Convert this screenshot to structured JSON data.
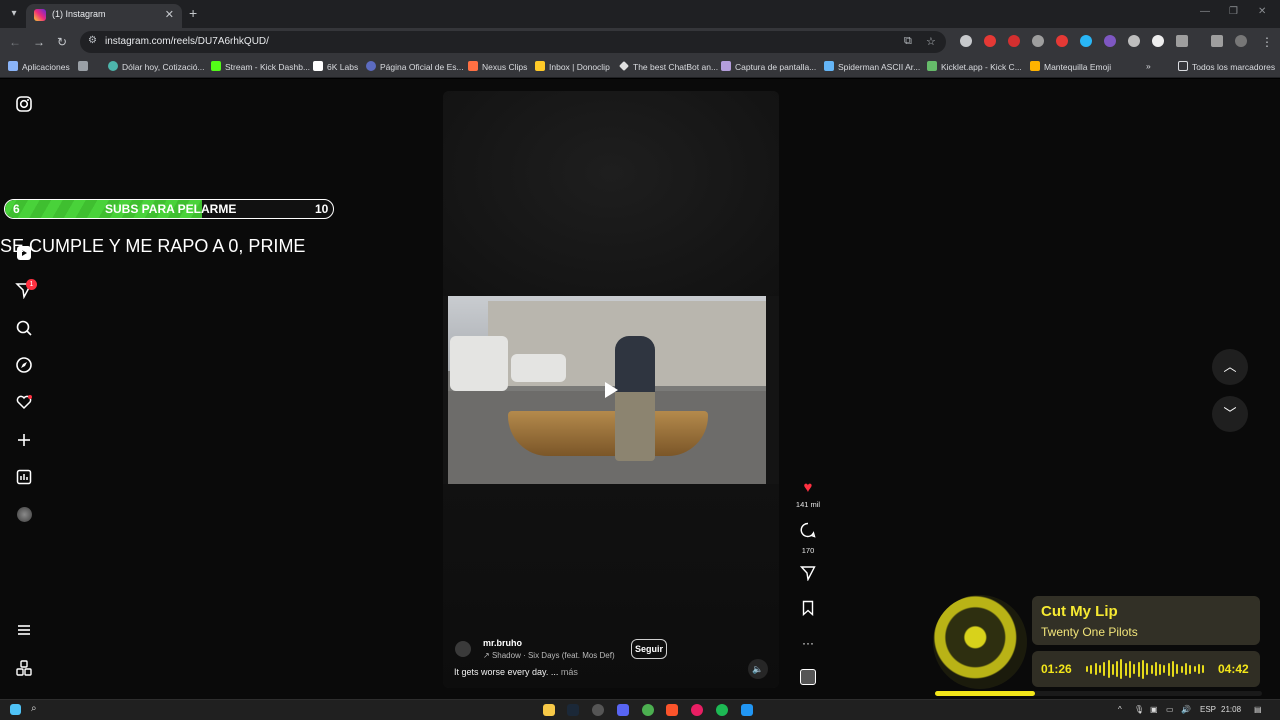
{
  "browser": {
    "tab_title": "(1) Instagram",
    "url": "instagram.com/reels/DU7A6rhkQUD/",
    "bookmarks": [
      "Aplicaciones",
      "Dólar hoy, Cotizació...",
      "Stream - Kick Dashb...",
      "6K Labs",
      "Página Oficial de Es...",
      "Nexus Clips",
      "Inbox | Donoclip",
      "The best ChatBot an...",
      "Captura de pantalla...",
      "Spiderman ASCII Ar...",
      "Kicklet.app - Kick C...",
      "Mantequilla Emoji"
    ],
    "bookmarks_folder": "Todos los marcadores"
  },
  "sidebar": {
    "notification_badge": "1"
  },
  "overlay": {
    "current": "6",
    "label": "SUBS PARA PELARME",
    "goal": "10",
    "progress_fraction": 0.6,
    "line": "SE CUMPLE Y ME RAPO A 0, PRIME"
  },
  "reel": {
    "author": "mr.bruho",
    "audio": "Shadow · Six Days (feat. Mos Def)",
    "follow_label": "Seguir",
    "caption": "It gets worse every day. ...",
    "more_label": "más",
    "likes": "141 mil",
    "comments": "170"
  },
  "music": {
    "title": "Cut My Lip",
    "artist": "Twenty One Pilots",
    "elapsed": "01:26",
    "duration": "04:42",
    "progress_fraction": 0.305,
    "accent": "#f3e61a"
  },
  "taskbar": {
    "lang": "ESP",
    "time": "21:08"
  }
}
